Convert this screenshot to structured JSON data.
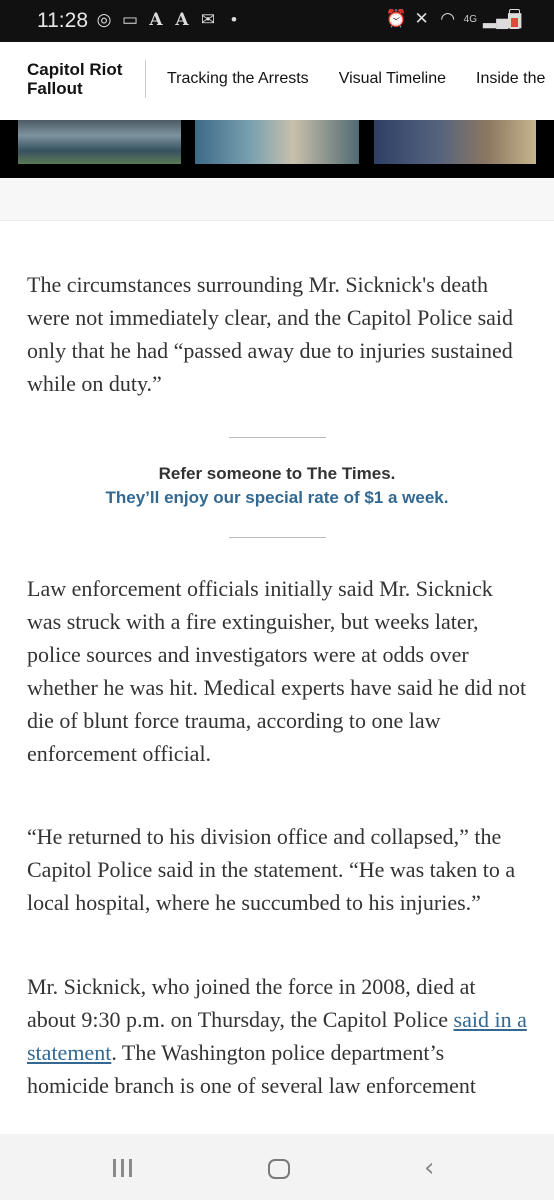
{
  "status_bar": {
    "time": "11:28",
    "left_icons": [
      "sync-icon",
      "message-icon",
      "font-a-icon",
      "font-a-icon",
      "mail-icon",
      "dot-icon"
    ],
    "right_icons": [
      "alarm-icon",
      "mute-icon",
      "wifi-icon",
      "signal-icon",
      "battery-icon"
    ],
    "network": "4G"
  },
  "navbar": {
    "brand_line1": "Capitol Riot",
    "brand_line2": "Fallout",
    "links": [
      "Tracking the Arrests",
      "Visual Timeline",
      "Inside the"
    ]
  },
  "article": {
    "p1": "The circumstances surrounding Mr. Sicknick's death were not immediately clear, and the Capitol Police said only that he had “passed away due to injuries sustained while on duty.”",
    "promo_title": "Refer someone to The Times.",
    "promo_sub": "They’ll enjoy our special rate of $1 a week.",
    "p2": "Law enforcement officials initially said Mr. Sicknick was struck with a fire extinguisher, but weeks later, police sources and investigators were at odds over whether he was hit. Medical experts have said he did not die of blunt force trauma, according to one law enforcement official.",
    "p3": "“He returned to his division office and collapsed,” the Capitol Police said in the statement. “He was taken to a local hospital, where he succumbed to his injuries.”",
    "p4_before": "Mr. Sicknick, who joined the force in 2008, died at about 9:30 p.m. on Thursday, the Capitol Police ",
    "p4_link": "said in a statement",
    "p4_after": ". The Washington police department’s homicide branch is one of several law enforcement"
  },
  "colors": {
    "link": "#326891",
    "text": "#333333"
  }
}
